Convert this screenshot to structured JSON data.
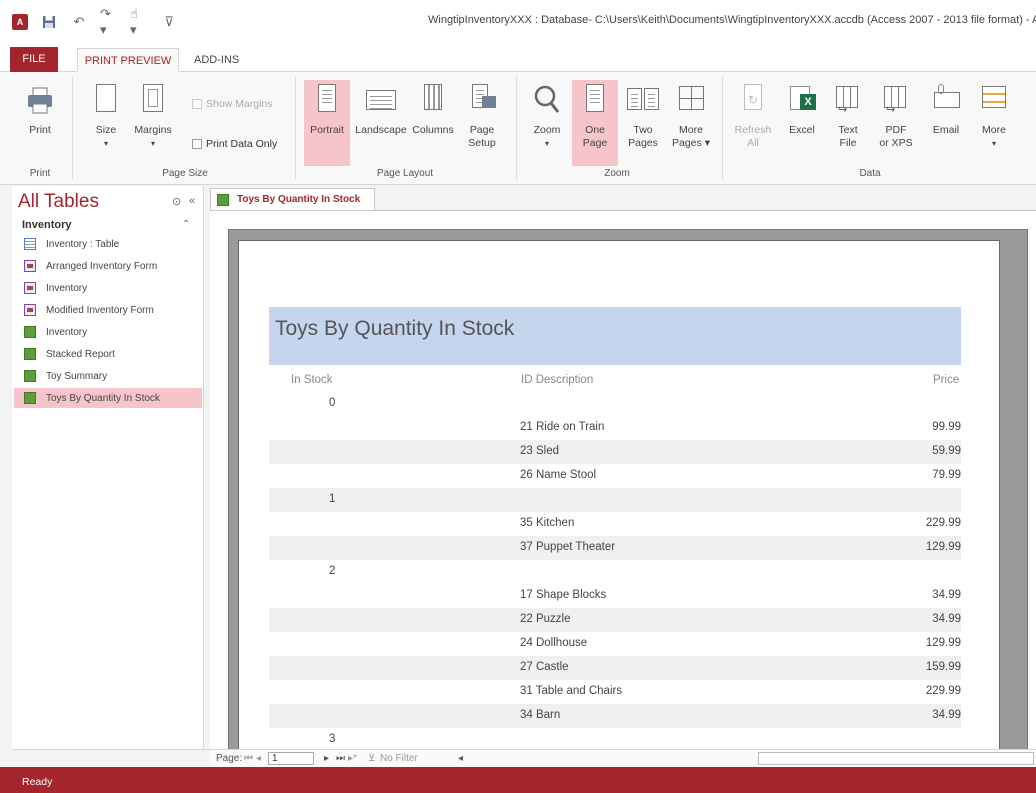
{
  "window": {
    "title": "WingtipInventoryXXX : Database- C:\\Users\\Keith\\Documents\\WingtipInventoryXXX.accdb (Access 2007 - 2013 file format) - A"
  },
  "tabs": {
    "file": "FILE",
    "print_preview": "PRINT PREVIEW",
    "add_ins": "ADD-INS"
  },
  "ribbon": {
    "print": "Print",
    "size": "Size",
    "margins": "Margins",
    "show_margins": "Show Margins",
    "print_data_only": "Print Data Only",
    "portrait": "Portrait",
    "landscape": "Landscape",
    "columns": "Columns",
    "page_setup_1": "Page",
    "page_setup_2": "Setup",
    "zoom": "Zoom",
    "one_page_1": "One",
    "one_page_2": "Page",
    "two_pages_1": "Two",
    "two_pages_2": "Pages",
    "more_pages_1": "More",
    "more_pages_2": "Pages",
    "refresh_1": "Refresh",
    "refresh_2": "All",
    "excel": "Excel",
    "text_file_1": "Text",
    "text_file_2": "File",
    "pdf_1": "PDF",
    "pdf_2": "or XPS",
    "email": "Email",
    "more": "More",
    "groups": {
      "print": "Print",
      "page_size": "Page Size",
      "page_layout": "Page Layout",
      "zoom": "Zoom",
      "data": "Data"
    }
  },
  "nav": {
    "title": "All Tables",
    "group": "Inventory",
    "items": [
      {
        "label": "Inventory : Table",
        "type": "table"
      },
      {
        "label": "Arranged Inventory Form",
        "type": "form"
      },
      {
        "label": "Inventory",
        "type": "form"
      },
      {
        "label": "Modified Inventory Form",
        "type": "form"
      },
      {
        "label": "Inventory",
        "type": "report"
      },
      {
        "label": "Stacked Report",
        "type": "report"
      },
      {
        "label": "Toy Summary",
        "type": "report"
      },
      {
        "label": "Toys By Quantity In Stock",
        "type": "report"
      }
    ]
  },
  "document": {
    "tab_label": "Toys By Quantity In Stock",
    "report_title": "Toys By Quantity In Stock",
    "headers": {
      "in_stock": "In Stock",
      "id_description": "ID  Description",
      "price": "Price"
    },
    "rows": [
      {
        "group": "0",
        "desc": "",
        "price": ""
      },
      {
        "group": "",
        "desc": "21  Ride on Train",
        "price": "99.99"
      },
      {
        "group": "",
        "desc": "23  Sled",
        "price": "59.99"
      },
      {
        "group": "",
        "desc": "26  Name Stool",
        "price": "79.99"
      },
      {
        "group": "1",
        "desc": "",
        "price": ""
      },
      {
        "group": "",
        "desc": "35  Kitchen",
        "price": "229.99"
      },
      {
        "group": "",
        "desc": "37  Puppet Theater",
        "price": "129.99"
      },
      {
        "group": "2",
        "desc": "",
        "price": ""
      },
      {
        "group": "",
        "desc": "17  Shape Blocks",
        "price": "34.99"
      },
      {
        "group": "",
        "desc": "22  Puzzle",
        "price": "34.99"
      },
      {
        "group": "",
        "desc": "24  Dollhouse",
        "price": "129.99"
      },
      {
        "group": "",
        "desc": "27  Castle",
        "price": "159.99"
      },
      {
        "group": "",
        "desc": "31  Table and Chairs",
        "price": "229.99"
      },
      {
        "group": "",
        "desc": "34  Barn",
        "price": "34.99"
      },
      {
        "group": "3",
        "desc": "",
        "price": ""
      }
    ]
  },
  "recnav": {
    "label": "Page:",
    "page_value": "1",
    "no_filter": "No Filter"
  },
  "status": "Ready",
  "colors": {
    "accent": "#a4262c",
    "highlight": "#f6c5c9",
    "title_band": "#c6d5ee"
  }
}
